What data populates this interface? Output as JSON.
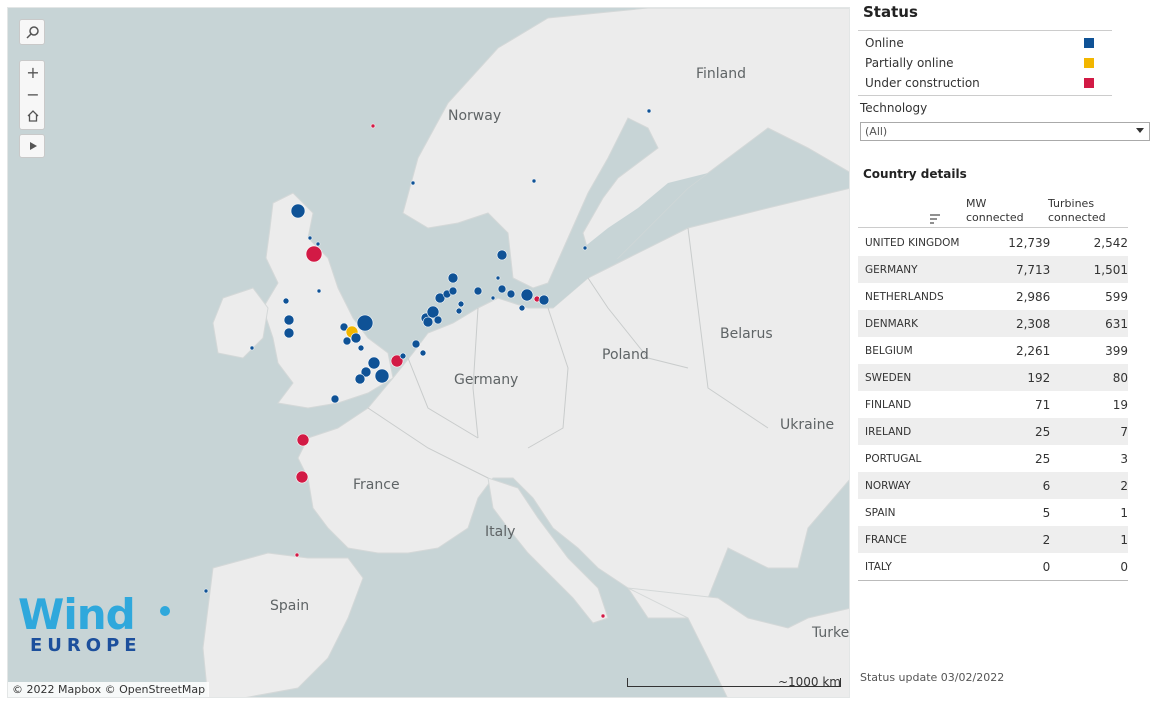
{
  "map": {
    "labels": {
      "norway": "Norway",
      "finland": "Finland",
      "germany": "Germany",
      "poland": "Poland",
      "belarus": "Belarus",
      "ukraine": "Ukraine",
      "france": "France",
      "italy": "Italy",
      "spain": "Spain",
      "turkey": "Turke"
    },
    "attribution": "© 2022 Mapbox © OpenStreetMap",
    "scale": "~1000 km",
    "controls": [
      "search-icon",
      "zoom-in-icon",
      "zoom-out-icon",
      "home-icon",
      "play-icon"
    ],
    "logo": {
      "wind": "Wind",
      "europe": "EUROPE"
    },
    "colors": {
      "online": "#0f5296",
      "partial": "#f2b600",
      "construction": "#d21a45",
      "sea": "#c7d4d6",
      "land": "#ececec"
    }
  },
  "panel": {
    "status_title": "Status",
    "legend": [
      {
        "label": "Online",
        "color": "#0f5296"
      },
      {
        "label": "Partially online",
        "color": "#f2b600"
      },
      {
        "label": "Under construction",
        "color": "#d21a45"
      }
    ],
    "technology_label": "Technology",
    "technology_value": "(All)",
    "country_title": "Country details",
    "headers": {
      "mw1": "MW",
      "mw2": "connected",
      "tu1": "Turbines",
      "tu2": "connected"
    },
    "rows": [
      {
        "country": "UNITED KINGDOM",
        "mw": "12,739",
        "turbines": "2,542"
      },
      {
        "country": "GERMANY",
        "mw": "7,713",
        "turbines": "1,501"
      },
      {
        "country": "NETHERLANDS",
        "mw": "2,986",
        "turbines": "599"
      },
      {
        "country": "DENMARK",
        "mw": "2,308",
        "turbines": "631"
      },
      {
        "country": "BELGIUM",
        "mw": "2,261",
        "turbines": "399"
      },
      {
        "country": "SWEDEN",
        "mw": "192",
        "turbines": "80"
      },
      {
        "country": "FINLAND",
        "mw": "71",
        "turbines": "19"
      },
      {
        "country": "IRELAND",
        "mw": "25",
        "turbines": "7"
      },
      {
        "country": "PORTUGAL",
        "mw": "25",
        "turbines": "3"
      },
      {
        "country": "NORWAY",
        "mw": "6",
        "turbines": "2"
      },
      {
        "country": "SPAIN",
        "mw": "5",
        "turbines": "1"
      },
      {
        "country": "FRANCE",
        "mw": "2",
        "turbines": "1"
      },
      {
        "country": "ITALY",
        "mw": "0",
        "turbines": "0"
      }
    ],
    "update": "Status update 03/02/2022"
  }
}
